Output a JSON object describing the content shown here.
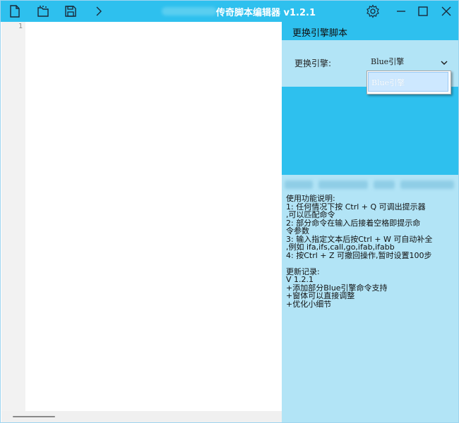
{
  "app": {
    "title": "传奇脚本编辑器 v1.2.1",
    "accent_color": "#2ec0ee",
    "panel_color": "#b2e4f6"
  },
  "toolbar": {
    "icons": [
      "new-file-icon",
      "open-folder-icon",
      "save-icon",
      "chevron-right-icon"
    ]
  },
  "window_controls": {
    "icons": [
      "settings-gear-icon",
      "minimize-icon",
      "maximize-icon",
      "close-icon"
    ]
  },
  "editor": {
    "line_numbers": [
      "1"
    ]
  },
  "panel": {
    "title": "更换引擎脚本",
    "engine_label": "更换引擎:",
    "engine_selected": "Blue引擎",
    "engine_options": [
      "Blue引擎"
    ]
  },
  "info": {
    "lines": [
      "使用功能说明:",
      "1: 任何情况下按 Ctrl + Q 可调出提示器",
      ",可以匹配命令",
      "2: 部分命令在输入后接着空格即提示命",
      "令参数",
      "3: 输入指定文本后按Ctrl + W 可自动补全",
      ",例如 ifa,ifs,call,go,ifab,ifabb",
      "4: 按Ctrl + Z 可撤回操作,暂时设置100步",
      "",
      "更新记录:",
      "V 1.2.1",
      "+添加部分Blue引擎命令支持",
      "+窗体可以直接调整",
      "+优化小细节"
    ]
  }
}
